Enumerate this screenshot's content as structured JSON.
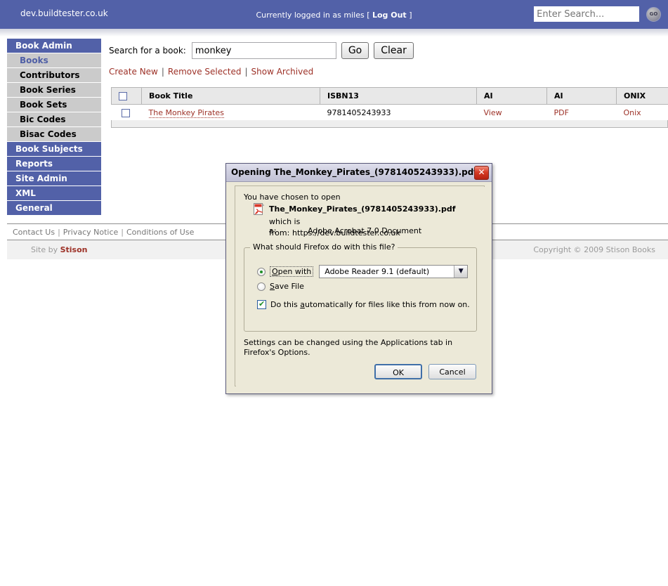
{
  "topbar": {
    "domain": "dev.buildtester.co.uk",
    "login_prefix": "Currently logged in as miles [ ",
    "logout_label": "Log Out",
    "login_suffix": " ]",
    "search_placeholder": "Enter Search...",
    "search_value": "",
    "go_label": "GO"
  },
  "sidebar": {
    "items": [
      {
        "label": "Book Admin",
        "type": "section"
      },
      {
        "label": "Books",
        "type": "sub",
        "active": true
      },
      {
        "label": "Contributors",
        "type": "sub",
        "active": false
      },
      {
        "label": "Book Series",
        "type": "sub",
        "active": false
      },
      {
        "label": "Book Sets",
        "type": "sub",
        "active": false
      },
      {
        "label": "Bic Codes",
        "type": "sub",
        "active": false
      },
      {
        "label": "Bisac Codes",
        "type": "sub",
        "active": false
      },
      {
        "label": "Book Subjects",
        "type": "section"
      },
      {
        "label": "Reports",
        "type": "section"
      },
      {
        "label": "Site Admin",
        "type": "section"
      },
      {
        "label": "XML",
        "type": "section"
      },
      {
        "label": "General",
        "type": "section"
      }
    ]
  },
  "main": {
    "search_label": "Search for a book:",
    "search_value": "monkey",
    "go_label": "Go",
    "clear_label": "Clear",
    "actions": {
      "create_new": "Create New",
      "remove_selected": "Remove Selected",
      "show_archived": "Show Archived",
      "separator": "|"
    },
    "table": {
      "headers": [
        "",
        "Book Title",
        "ISBN13",
        "AI",
        "AI",
        "ONIX"
      ],
      "rows": [
        {
          "title": "The Monkey Pirates",
          "isbn13": "9781405243933",
          "ai_view": "View",
          "ai_pdf": "PDF",
          "onix": "Onix"
        }
      ]
    }
  },
  "footer": {
    "links": [
      "Contact Us",
      "Privacy Notice",
      "Conditions of Use"
    ],
    "separator": "|",
    "site_by_prefix": "Site by ",
    "site_by_name": "Stison",
    "copyright": "Copyright © 2009 Stison Books"
  },
  "dialog": {
    "title": "Opening The_Monkey_Pirates_(9781405243933).pdf",
    "close_label": "✕",
    "chosen_text": "You have chosen to open",
    "file_name": "The_Monkey_Pirates_(9781405243933).pdf",
    "which_is_a_key": "which is a:",
    "which_is_a_value": "Adobe Acrobat 7.0 Document",
    "from_key": "from:",
    "from_value": "https://dev.buildtester.co.uk",
    "fieldset_legend": "What should Firefox do with this file?",
    "open_with_label": "Open with",
    "open_with_accel": "O",
    "app_select_value": "Adobe Reader 9.1 (default)",
    "select_arrow": "▼",
    "save_file_label": "Save File",
    "save_file_accel": "S",
    "auto_label_pre": "Do this ",
    "auto_label_accel": "a",
    "auto_label_post": "utomatically for files like this from now on.",
    "settings_note": "Settings can be changed using the Applications tab in Firefox's Options.",
    "ok_label": "OK",
    "cancel_label": "Cancel"
  },
  "colors": {
    "brand_blue": "#5261a8",
    "link_red": "#9d3127",
    "dialog_bg": "#ece9d8"
  }
}
